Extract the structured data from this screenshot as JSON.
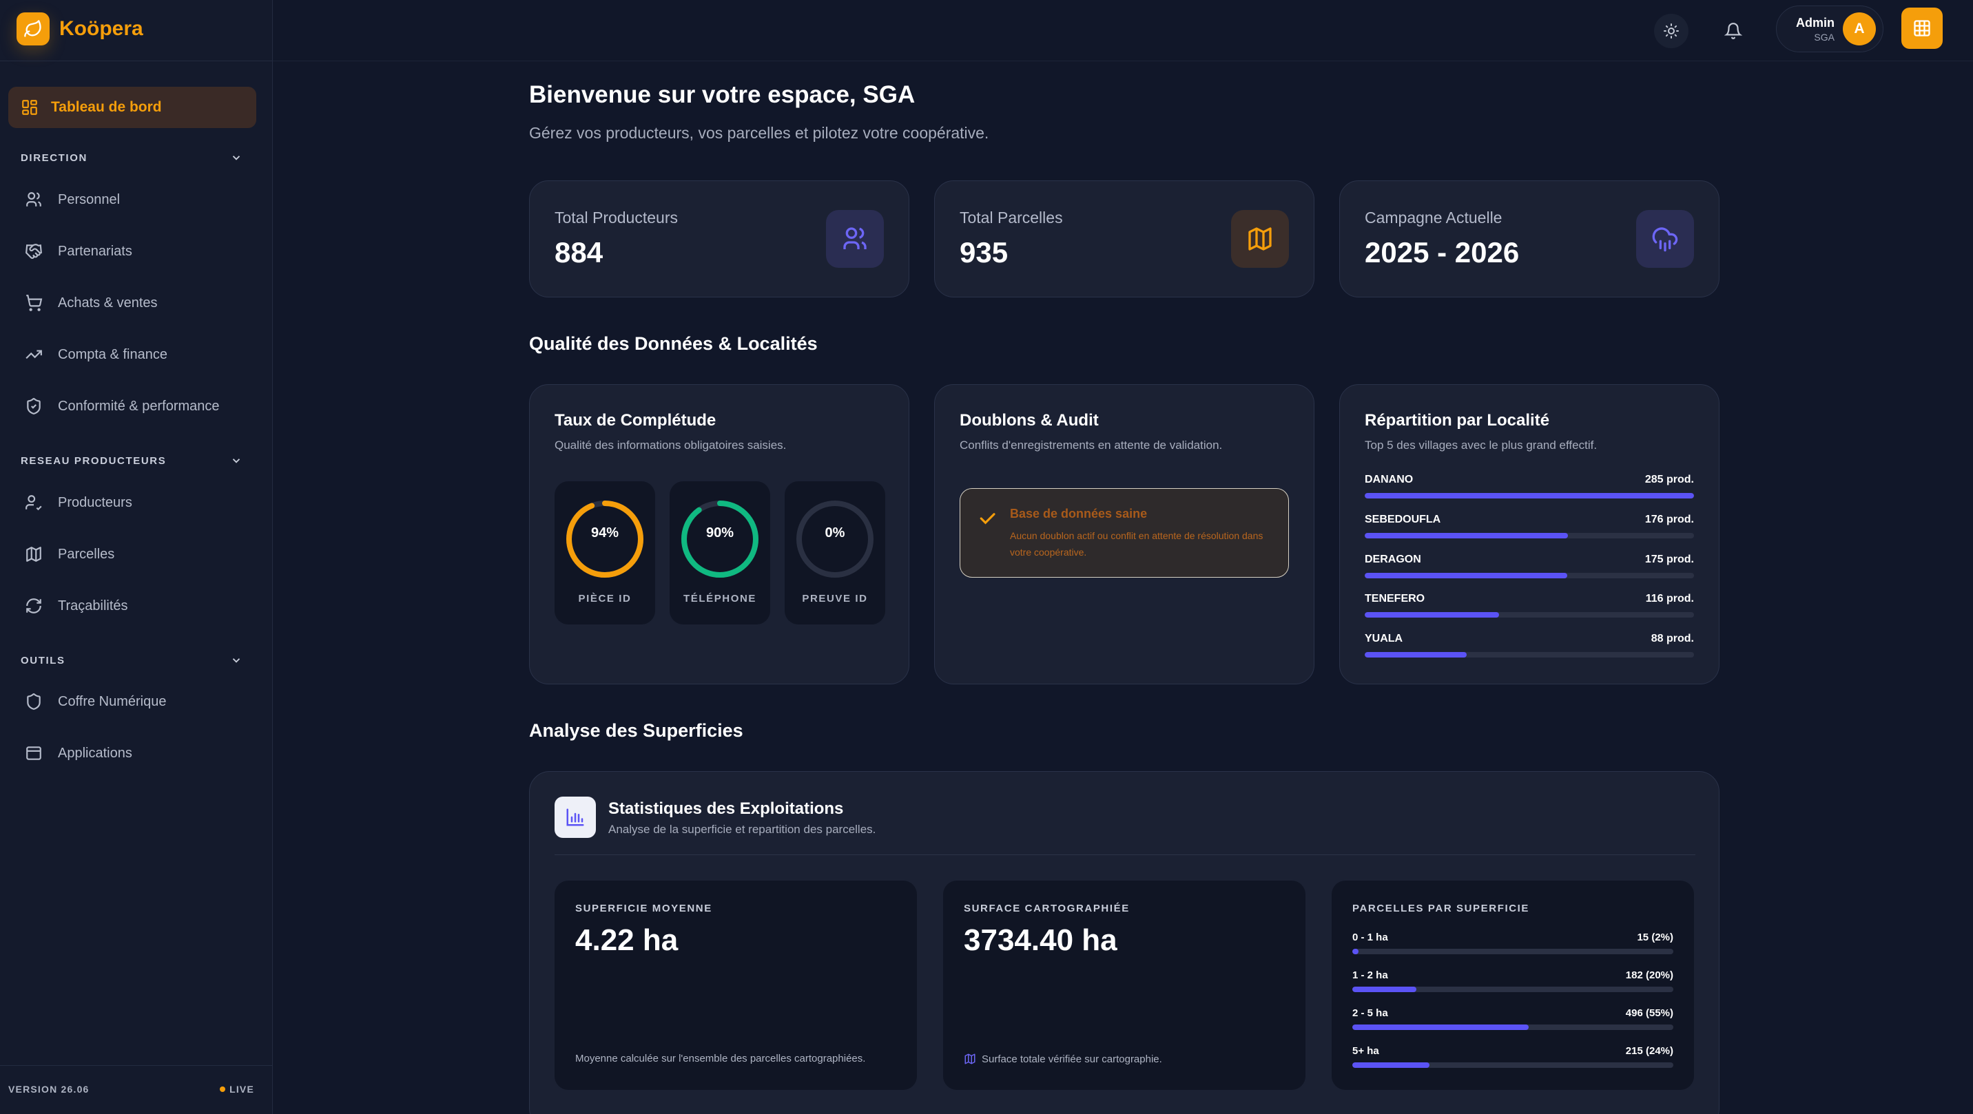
{
  "app": {
    "name": "Koöpera"
  },
  "sidebar": {
    "active": {
      "label": "Tableau de bord"
    },
    "sections": [
      {
        "title": "DIRECTION",
        "items": [
          {
            "label": "Personnel",
            "icon": "users-icon"
          },
          {
            "label": "Partenariats",
            "icon": "handshake-icon"
          },
          {
            "label": "Achats & ventes",
            "icon": "cart-icon"
          },
          {
            "label": "Compta & finance",
            "icon": "trend-icon"
          },
          {
            "label": "Conformité & performance",
            "icon": "shield-check-icon"
          }
        ]
      },
      {
        "title": "RESEAU PRODUCTEURS",
        "items": [
          {
            "label": "Producteurs",
            "icon": "user-check-icon"
          },
          {
            "label": "Parcelles",
            "icon": "map-icon"
          },
          {
            "label": "Traçabilités",
            "icon": "refresh-icon"
          }
        ]
      },
      {
        "title": "OUTILS",
        "items": [
          {
            "label": "Coffre Numérique",
            "icon": "shield-icon"
          },
          {
            "label": "Applications",
            "icon": "window-icon"
          }
        ]
      }
    ],
    "footer": {
      "version": "VERSION 26.06",
      "status": "LIVE"
    }
  },
  "topbar": {
    "user_name": "Admin",
    "user_org": "SGA",
    "avatar_initial": "A"
  },
  "main": {
    "title": "Bienvenue sur votre espace, SGA",
    "subtitle": "Gérez vos producteurs, vos parcelles et pilotez votre coopérative.",
    "stats": [
      {
        "label": "Total Producteurs",
        "value": "884",
        "icon": "users-icon"
      },
      {
        "label": "Total Parcelles",
        "value": "935",
        "icon": "map-icon"
      },
      {
        "label": "Campagne Actuelle",
        "value": "2025 - 2026",
        "icon": "cloud-rain-icon"
      }
    ],
    "quality": {
      "heading": "Qualité des Données & Localités",
      "completeness": {
        "title": "Taux de Complétude",
        "subtitle": "Qualité des informations obligatoires saisies.",
        "gauges": [
          {
            "label": "PIÈCE ID",
            "value": "94%",
            "pct": 94,
            "color": "#f59e0b"
          },
          {
            "label": "TÉLÉPHONE",
            "value": "90%",
            "pct": 90,
            "color": "#10b981"
          },
          {
            "label": "PREUVE ID",
            "value": "0%",
            "pct": 0,
            "color": "#e5e7eb"
          }
        ]
      },
      "audit": {
        "title": "Doublons & Audit",
        "subtitle": "Conflits d'enregistrements en attente de validation.",
        "ok_title": "Base de données saine",
        "ok_text": "Aucun doublon actif ou conflit en attente de résolution dans votre coopérative."
      },
      "localities": {
        "title": "Répartition par Localité",
        "subtitle": "Top 5 des villages avec le plus grand effectif.",
        "rows": [
          {
            "name": "DANANO",
            "value": "285 prod.",
            "count": 285
          },
          {
            "name": "SEBEDOUFLA",
            "value": "176 prod.",
            "count": 176
          },
          {
            "name": "DERAGON",
            "value": "175 prod.",
            "count": 175
          },
          {
            "name": "TENEFERO",
            "value": "116 prod.",
            "count": 116
          },
          {
            "name": "YUALA",
            "value": "88 prod.",
            "count": 88
          }
        ]
      }
    },
    "surface": {
      "heading": "Analyse des Superficies",
      "title": "Statistiques des Exploitations",
      "subtitle": "Analyse de la superficie et repartition des parcelles.",
      "avg": {
        "label": "SUPERFICIE MOYENNE",
        "value": "4.22 ha",
        "foot": "Moyenne calculée sur l'ensemble des parcelles cartographiées."
      },
      "mapped": {
        "label": "SURFACE CARTOGRAPHIÉE",
        "value": "3734.40 ha",
        "foot": "Surface totale vérifiée sur cartographie."
      },
      "distribution": {
        "label": "PARCELLES PAR SUPERFICIE",
        "rows": [
          {
            "range": "0 - 1 ha",
            "value": "15 (2%)",
            "pct": 2
          },
          {
            "range": "1 - 2 ha",
            "value": "182 (20%)",
            "pct": 20
          },
          {
            "range": "2 - 5 ha",
            "value": "496 (55%)",
            "pct": 55
          },
          {
            "range": "5+ ha",
            "value": "215 (24%)",
            "pct": 24
          }
        ]
      }
    }
  },
  "colors": {
    "accent": "#f59e0b",
    "indigo": "#5b53f5",
    "green": "#10b981",
    "bg": "#111729",
    "card": "#1b2133"
  }
}
